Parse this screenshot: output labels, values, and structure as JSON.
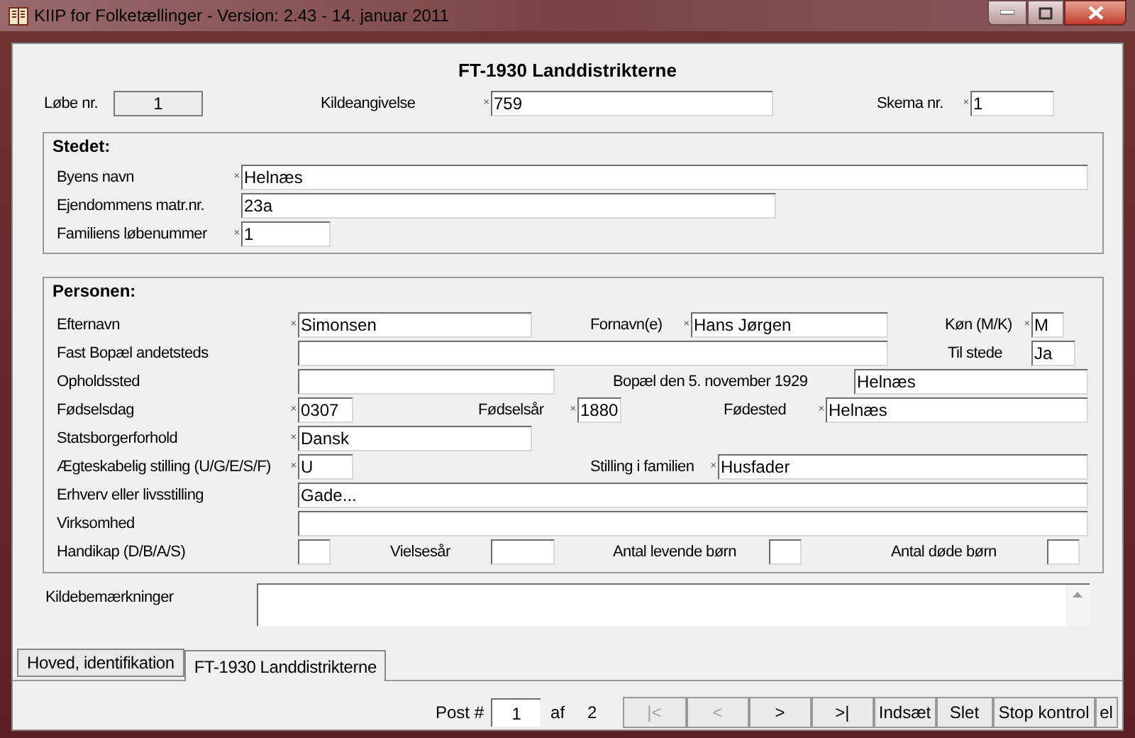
{
  "window": {
    "title": "KIIP for Folketællinger - Version: 2.43 - 14. januar 2011"
  },
  "form_title": "FT-1930 Landdistrikterne",
  "header_fields": [
    {
      "label": "Løbe nr.",
      "value": "1",
      "kind": "readonly"
    },
    {
      "label": "Kildeangivelse",
      "mark": "×",
      "value": "759",
      "kind": "input"
    },
    {
      "label": "Skema nr.",
      "mark": "×",
      "value": "1",
      "kind": "input"
    }
  ],
  "sections": [
    {
      "title": "Stedet:",
      "fields": [
        {
          "label": "Byens navn",
          "mark": "×",
          "value": "Helnæs"
        },
        {
          "label": "Ejendommens matr.nr.",
          "value": "23a"
        },
        {
          "label": "Familiens løbenummer",
          "mark": "×",
          "value": "1"
        }
      ]
    },
    {
      "title": "Personen:",
      "fields": [
        {
          "label": "Efternavn",
          "mark": "×",
          "value": "Simonsen"
        },
        {
          "label": "Fornavn(e)",
          "mark": "×",
          "value": "Hans Jørgen"
        },
        {
          "label": "Køn (M/K)",
          "mark": "×",
          "value": "M"
        },
        {
          "label": "Fast Bopæl andetsteds"
        },
        {
          "label": "Til stede",
          "value": "Ja"
        },
        {
          "label": "Opholdssted"
        },
        {
          "label": "Bopæl den 5. november 1929",
          "value": "Helnæs"
        },
        {
          "label": "Fødselsdag",
          "mark": "×",
          "value": "0307"
        },
        {
          "label": "Fødselsår",
          "mark": "×",
          "value": "1880"
        },
        {
          "label": "Fødested",
          "mark": "×",
          "value": "Helnæs"
        },
        {
          "label": "Statsborgerforhold",
          "mark": "×",
          "value": "Dansk"
        },
        {
          "label": "Ægteskabelig stilling (U/G/E/S/F)",
          "mark": "×",
          "value": "U"
        },
        {
          "label": "Stilling i familien",
          "mark": "×",
          "value": "Husfader"
        },
        {
          "label": "Erhverv eller livsstilling",
          "value": "Gade..."
        },
        {
          "label": "Virksomhed"
        },
        {
          "label": "Handikap (D/B/A/S)"
        },
        {
          "label": "Vielsesår"
        },
        {
          "label": "Antal levende børn"
        },
        {
          "label": "Antal døde børn"
        }
      ]
    }
  ],
  "remarks": {
    "label": "Kildebemærkninger"
  },
  "tabs": [
    {
      "label": "Hoved, identifikation",
      "selected": false
    },
    {
      "label": "FT-1930 Landdistrikterne",
      "selected": true
    }
  ],
  "navigation": {
    "post_label": "Post #",
    "post_value": "1",
    "of_label": "af",
    "total": "2",
    "buttons": [
      {
        "label": "|<",
        "disabled": true
      },
      {
        "label": "<",
        "disabled": true
      },
      {
        "label": ">",
        "disabled": false
      },
      {
        "label": ">|",
        "disabled": false
      },
      {
        "label": "Indsæt",
        "disabled": false
      },
      {
        "label": "Slet",
        "disabled": false
      },
      {
        "label": "Stop kontrol",
        "disabled": false
      },
      {
        "label": "el",
        "disabled": false
      }
    ]
  }
}
